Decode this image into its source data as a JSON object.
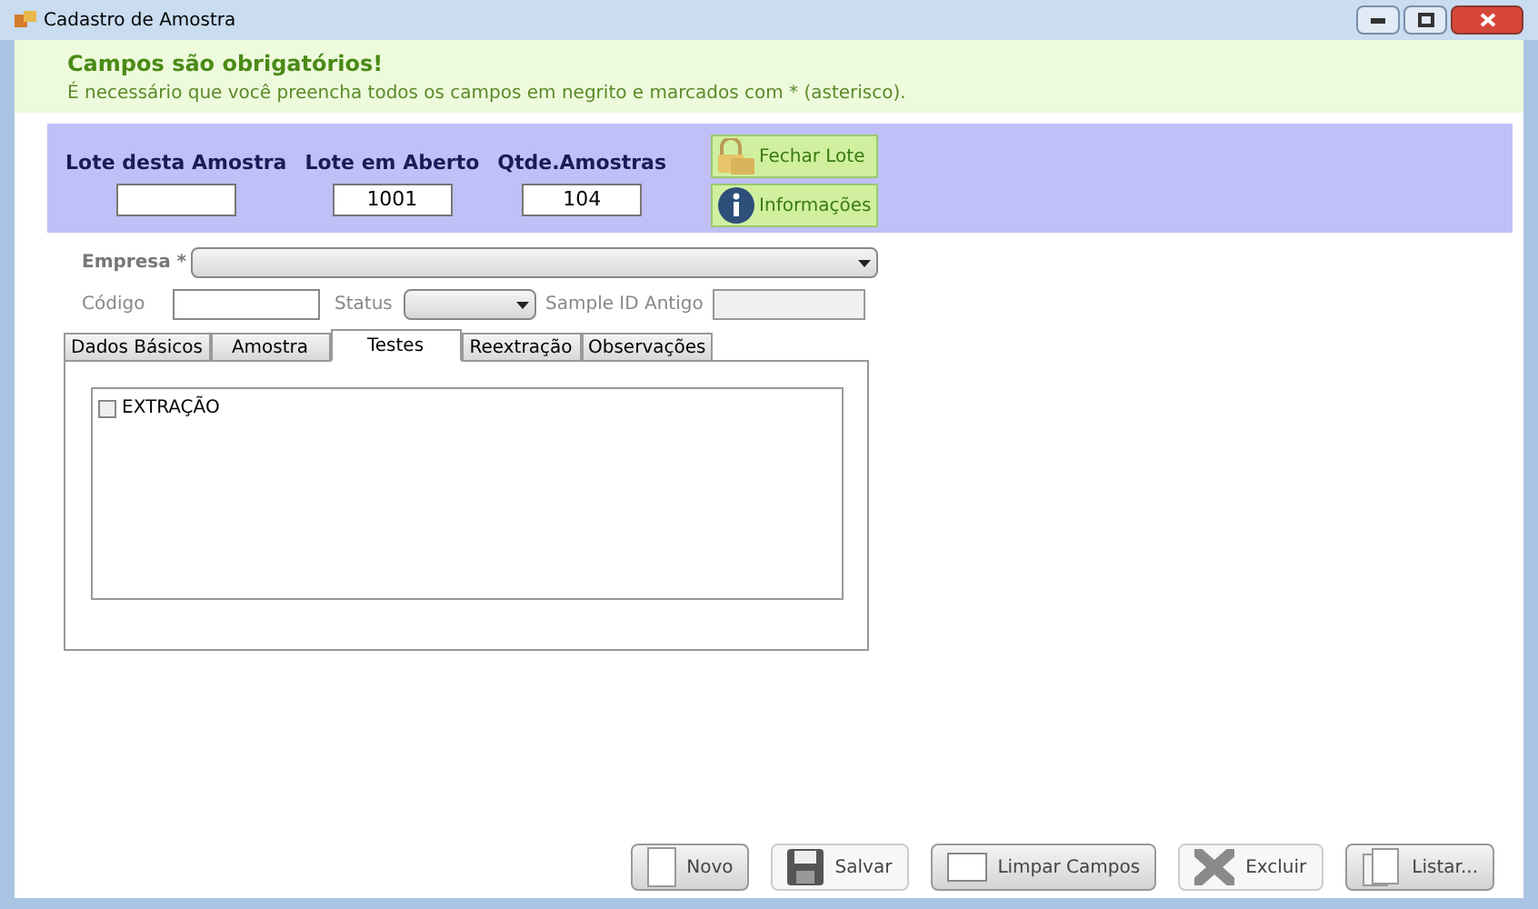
{
  "window": {
    "title": "Cadastro de Amostra"
  },
  "notice": {
    "title": "Campos são obrigatórios!",
    "text": "É necessário que você preencha todos os campos em negrito e marcados com * (asterisco)."
  },
  "batch": {
    "fields": [
      {
        "label": "Lote desta Amostra"
      },
      {
        "label": "Lote em Aberto",
        "value": "1001"
      },
      {
        "label": "Qtde.Amostras",
        "value": "104"
      }
    ],
    "buttons": [
      {
        "label": "Fechar Lote",
        "kind": "lock"
      },
      {
        "label": "Informações",
        "kind": "info"
      }
    ]
  },
  "empresa": {
    "label": "Empresa *"
  },
  "codigo": {
    "label": "Código"
  },
  "status": {
    "label": "Status"
  },
  "sample_id": {
    "label": "Sample ID Antigo",
    "disabled": true
  },
  "tabs": [
    {
      "label": "Dados Básicos",
      "selected": false
    },
    {
      "label": "Amostra",
      "selected": false
    },
    {
      "label": "Testes",
      "selected": true
    },
    {
      "label": "Reextração",
      "selected": false
    },
    {
      "label": "Observações",
      "selected": false
    }
  ],
  "tests": [
    {
      "label": "EXTRAÇÃO",
      "checked": false
    }
  ],
  "buttons": [
    {
      "label": "Novo",
      "kind": "blank",
      "disabled": false
    },
    {
      "label": "Salvar",
      "kind": "disk",
      "disabled": true
    },
    {
      "label": "Limpar Campos",
      "kind": "frame",
      "disabled": false
    },
    {
      "label": "Excluir",
      "kind": "cross",
      "disabled": true
    },
    {
      "label": "Listar...",
      "kind": "pages",
      "disabled": false
    }
  ]
}
